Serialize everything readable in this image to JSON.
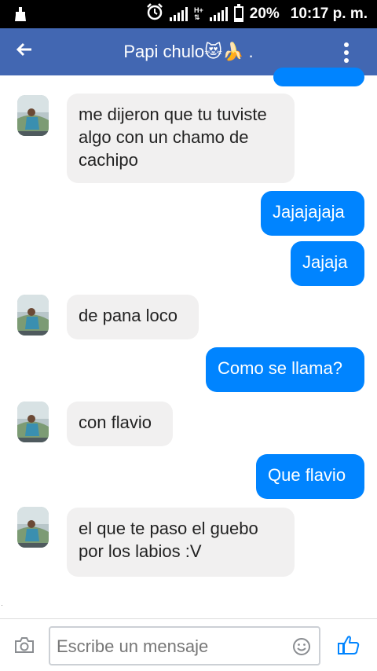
{
  "status_bar": {
    "battery": "20%",
    "time": "10:17 p. m."
  },
  "header": {
    "title": "Papi chulo😻🍌 ."
  },
  "messages": [
    {
      "side": "in",
      "text": "me dijeron que tu tuviste algo con un chamo de cachipo"
    },
    {
      "side": "out",
      "text": "Jajajajaja"
    },
    {
      "side": "out",
      "text": "Jajaja"
    },
    {
      "side": "in",
      "text": "de pana loco"
    },
    {
      "side": "out",
      "text": "Como se llama?"
    },
    {
      "side": "in",
      "text": "con flavio"
    },
    {
      "side": "out",
      "text": "Que flavio"
    },
    {
      "side": "in",
      "text": "el que te paso el guebo por los labios :V"
    }
  ],
  "composer": {
    "placeholder": "Escribe un mensaje"
  },
  "colors": {
    "header": "#4267b2",
    "outgoing": "#0084ff",
    "incoming": "#f1f0f0"
  }
}
